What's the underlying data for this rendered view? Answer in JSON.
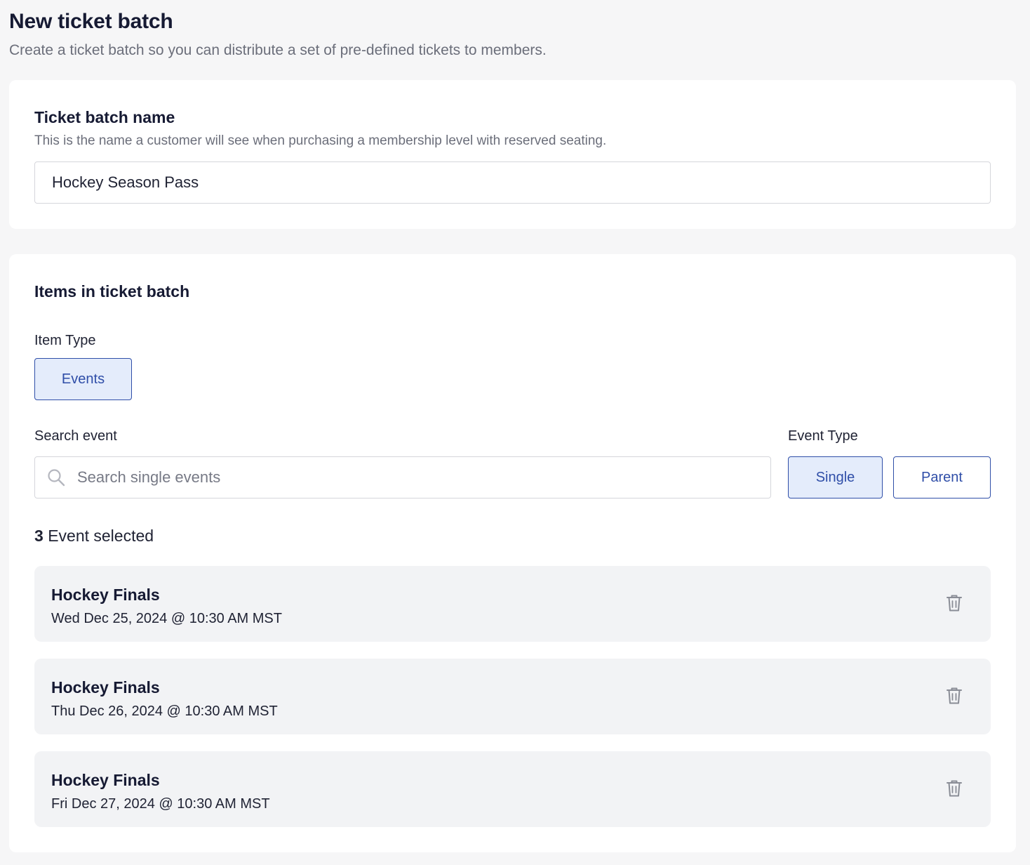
{
  "header": {
    "title": "New ticket batch",
    "subtitle": "Create a ticket batch so you can distribute a set of pre-defined tickets to members."
  },
  "name_card": {
    "title": "Ticket batch name",
    "description": "This is the name a customer will see when purchasing a membership level with reserved seating.",
    "value": "Hockey Season Pass"
  },
  "items_card": {
    "title": "Items in ticket batch",
    "item_type_label": "Item Type",
    "item_type_options": [
      "Events"
    ],
    "item_type_selected": "Events",
    "search_label": "Search event",
    "search_placeholder": "Search single events",
    "search_value": "",
    "event_type_label": "Event Type",
    "event_type_options": [
      "Single",
      "Parent"
    ],
    "event_type_selected": "Single",
    "selected_count": "3",
    "selected_suffix": "Event selected",
    "events": [
      {
        "name": "Hockey Finals",
        "date": "Wed Dec 25, 2024 @ 10:30 AM MST"
      },
      {
        "name": "Hockey Finals",
        "date": "Thu Dec 26, 2024 @ 10:30 AM MST"
      },
      {
        "name": "Hockey Finals",
        "date": "Fri Dec 27, 2024 @ 10:30 AM MST"
      }
    ]
  },
  "icons": {
    "search": "search-icon",
    "delete": "trash-icon"
  },
  "colors": {
    "background": "#f6f6f7",
    "card": "#ffffff",
    "accent": "#2f4ea8",
    "accent_bg": "#e4ecfb",
    "event_bg": "#f2f3f5",
    "muted_text": "#6b6e7a",
    "icon": "#8a8d96"
  }
}
